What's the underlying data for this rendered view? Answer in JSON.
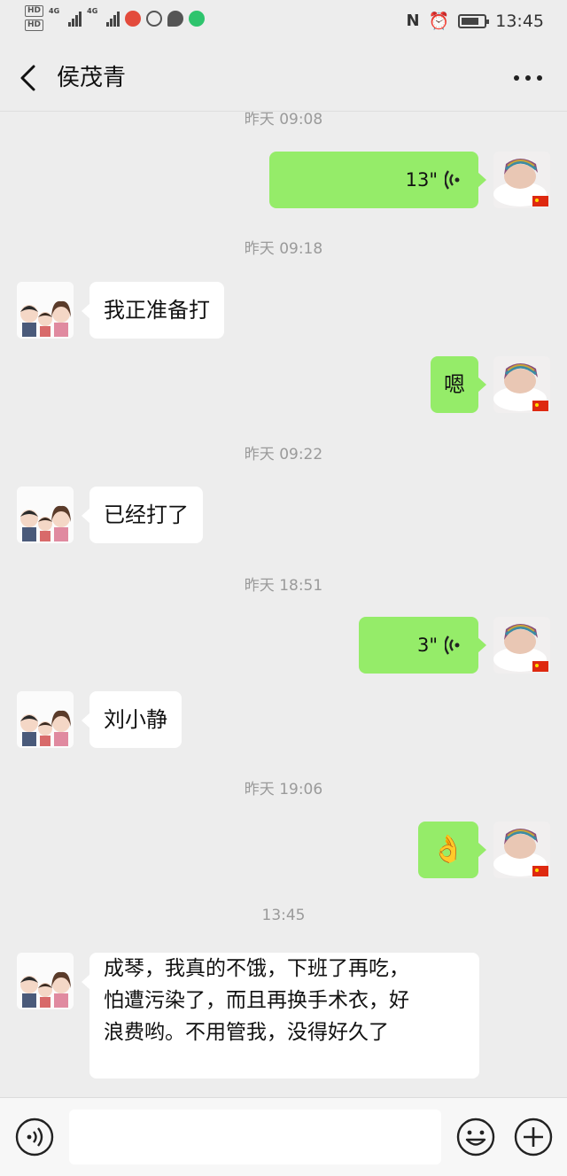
{
  "status_bar": {
    "sim1": "HD",
    "sim2": "HD",
    "net1": "4G",
    "net2": "4G",
    "time": "13:45",
    "battery_level": 0.8
  },
  "nav": {
    "title": "侯茂青",
    "back_icon": "chevron-left-icon",
    "more_icon": "more-dots-icon"
  },
  "chat": {
    "ts1": "昨天 09:08",
    "msg1_voice_len": "13\"",
    "ts2": "昨天 09:18",
    "msg2": "我正准备打",
    "msg3": "嗯",
    "ts3": "昨天 09:22",
    "msg4": "已经打了",
    "ts4": "昨天 18:51",
    "msg5_voice_len": "3\"",
    "msg6": "刘小静",
    "ts5": "昨天 19:06",
    "msg7_emoji": "👌",
    "ts6": "13:45",
    "msg8_line1": "成琴，我真的不饿，下班了再吃，",
    "msg8_line2": "怕遭污染了，而且再换手术衣，好",
    "msg8_line3": "浪费哟。不用管我，没得好久了"
  },
  "input_bar": {
    "voice_icon": "voice-mode-icon",
    "emoji_icon": "emoji-icon",
    "plus_icon": "plus-icon"
  }
}
